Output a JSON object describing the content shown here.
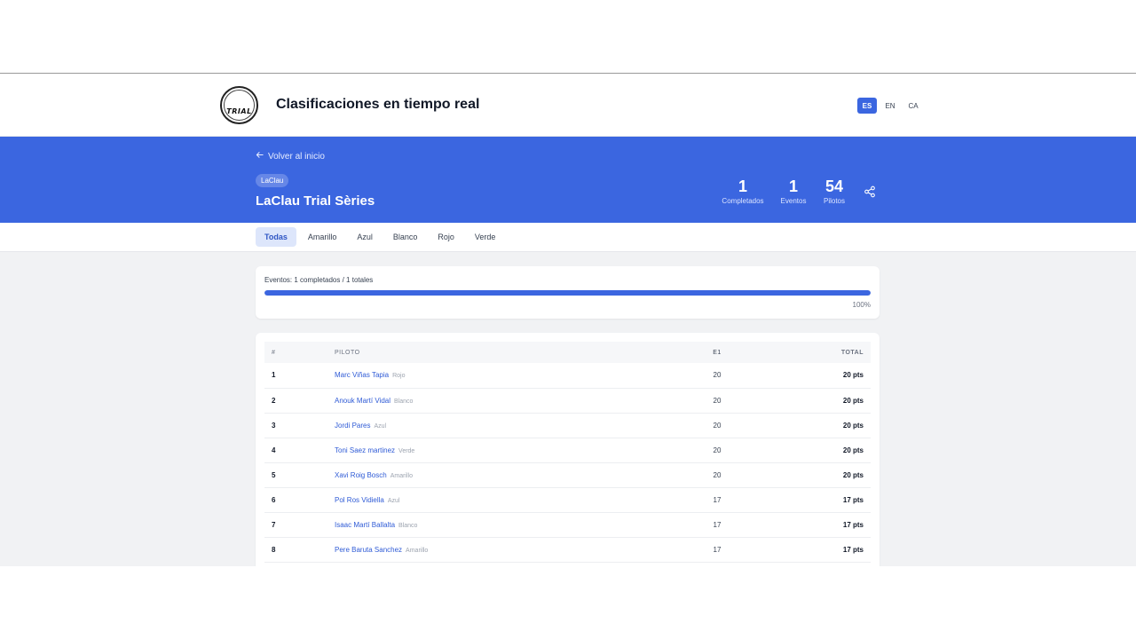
{
  "header": {
    "logo_text": "TRIAL",
    "title": "Clasificaciones en tiempo real",
    "languages": [
      {
        "code": "ES",
        "active": true
      },
      {
        "code": "EN",
        "active": false
      },
      {
        "code": "CA",
        "active": false
      }
    ]
  },
  "hero": {
    "back_label": "Volver al inicio",
    "org_tag": "LaClau",
    "event_title": "LaClau Trial Sèries",
    "stats": [
      {
        "value": "1",
        "label": "Completados"
      },
      {
        "value": "1",
        "label": "Eventos"
      },
      {
        "value": "54",
        "label": "Pilotos"
      }
    ],
    "share_icon": "share-icon"
  },
  "tabs": [
    "Todas",
    "Amarillo",
    "Azul",
    "Blanco",
    "Rojo",
    "Verde"
  ],
  "active_tab": "Todas",
  "progress": {
    "label": "Eventos: 1 completados / 1 totales",
    "fraction": 1.0,
    "percent_label": "100%"
  },
  "colors": {
    "accent": "#3b66e0",
    "link": "#2f5bd6"
  },
  "table": {
    "columns": {
      "rank": "#",
      "pilot": "PILOTO",
      "e1": "E1",
      "total": "TOTAL"
    },
    "rows": [
      {
        "rank": "1",
        "name": "Marc Viñas Tapia",
        "category": "Rojo",
        "e1": "20",
        "total": "20 pts"
      },
      {
        "rank": "2",
        "name": "Anouk Martí Vidal",
        "category": "Blanco",
        "e1": "20",
        "total": "20 pts"
      },
      {
        "rank": "3",
        "name": "Jordi Pares",
        "category": "Azul",
        "e1": "20",
        "total": "20 pts"
      },
      {
        "rank": "4",
        "name": "Toni Saez martinez",
        "category": "Verde",
        "e1": "20",
        "total": "20 pts"
      },
      {
        "rank": "5",
        "name": "Xavi Roig Bosch",
        "category": "Amarillo",
        "e1": "20",
        "total": "20 pts"
      },
      {
        "rank": "6",
        "name": "Pol Ros Vidiella",
        "category": "Azul",
        "e1": "17",
        "total": "17 pts"
      },
      {
        "rank": "7",
        "name": "Isaac Martí Ballalta",
        "category": "Blanco",
        "e1": "17",
        "total": "17 pts"
      },
      {
        "rank": "8",
        "name": "Pere Baruta Sanchez",
        "category": "Amarillo",
        "e1": "17",
        "total": "17 pts"
      }
    ]
  }
}
